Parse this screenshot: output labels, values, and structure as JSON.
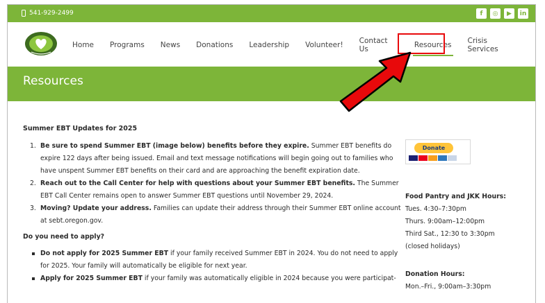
{
  "topbar": {
    "phone": "541-929-2499",
    "socials": [
      {
        "icon": "facebook-icon",
        "glyph": "f"
      },
      {
        "icon": "instagram-icon",
        "glyph": "◎"
      },
      {
        "icon": "youtube-icon",
        "glyph": "▶"
      },
      {
        "icon": "linkedin-icon",
        "glyph": "in"
      }
    ]
  },
  "nav": {
    "items": [
      {
        "label": "Home"
      },
      {
        "label": "Programs"
      },
      {
        "label": "News"
      },
      {
        "label": "Donations"
      },
      {
        "label": "Leadership"
      },
      {
        "label": "Volunteer!"
      },
      {
        "label": "Contact Us"
      },
      {
        "label": "Resources",
        "active": true
      },
      {
        "label": "Crisis Services"
      }
    ]
  },
  "banner": {
    "title": "Resources"
  },
  "main": {
    "heading": "Summer EBT Updates for 2025",
    "steps": [
      {
        "num": "1.",
        "bold": "Be sure to spend Summer EBT (image below) benefits before they expire.",
        "text": " Summer EBT benefits do expire 122 days after being issued. Email and text message notifications will begin going out to families who have unspent Summer EBT benefits on their card and are approaching the benefit expiration date."
      },
      {
        "num": "2.",
        "bold": "Reach out to the Call Center for help with questions about your Summer EBT benefits.",
        "text": " The Summer EBT Call Center remains open to answer Summer EBT questions until November 29, 2024."
      },
      {
        "num": "3.",
        "bold": "Moving? Update your address.",
        "text": " Families can update their address through their Summer EBT online account at sebt.oregon.gov."
      }
    ],
    "apply_heading": "Do you need to apply?",
    "bullets": [
      {
        "bold": "Do not apply for 2025 Summer EBT",
        "text": " if your family received Summer EBT in 2024. You do not need to apply for 2025. Your family will automatically be eligible for next year."
      },
      {
        "bold": "Apply for 2025 Summer EBT",
        "text": " if your family was automatically eligible in 2024 because you were participat-"
      }
    ]
  },
  "side": {
    "donate_label": "Donate",
    "pantry_title": "Food Pantry and JKK Hours:",
    "pantry_hours": [
      "Tues. 4:30–7:30pm",
      "Thurs. 9:00am–12:00pm",
      "Third Sat., 12:30 to 3:30pm",
      "(closed holidays)"
    ],
    "donation_title": "Donation Hours:",
    "donation_hours": [
      "Mon.–Fri., 9:00am–3:30pm"
    ]
  },
  "colors": {
    "brand_green": "#7db539",
    "highlight_red": "#e8090b",
    "paypal_yellow": "#ffc439"
  }
}
